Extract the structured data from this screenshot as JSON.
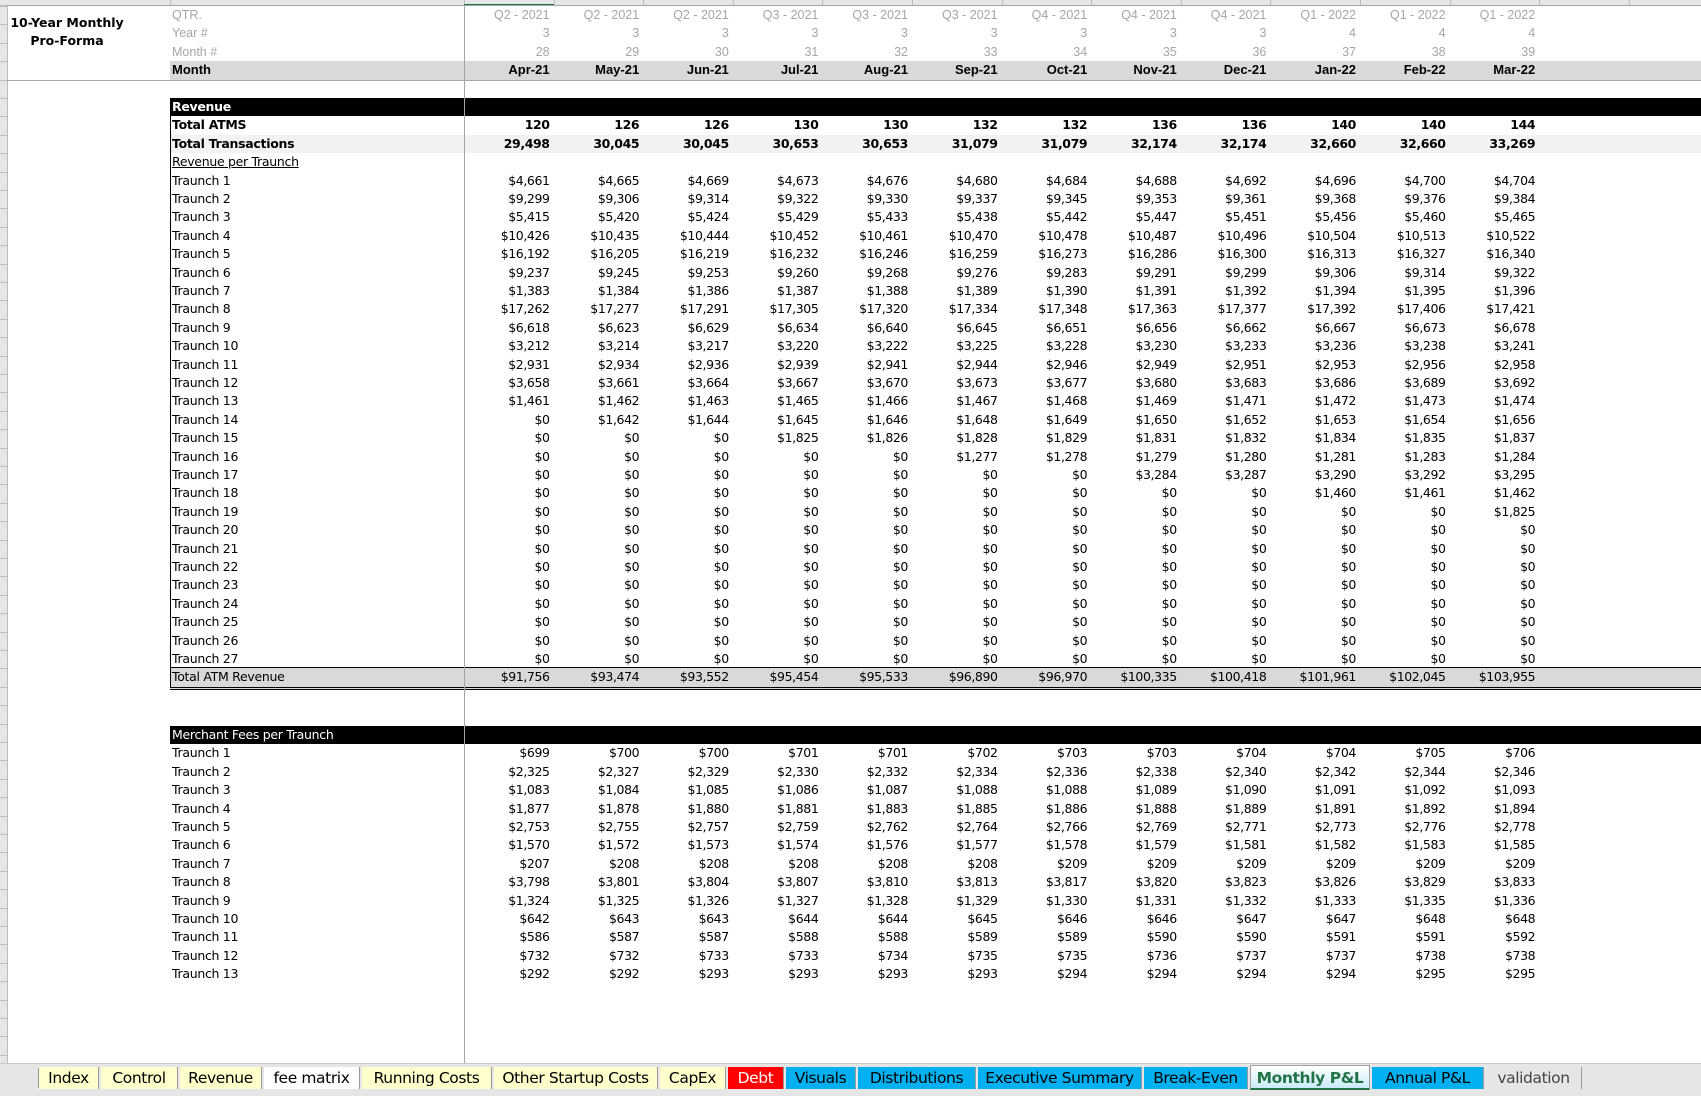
{
  "title": "10-Year Monthly Pro-Forma",
  "title_lines": [
    "10-Year Monthly",
    "Pro-Forma"
  ],
  "header": {
    "labels": {
      "qtr": "QTR.",
      "year": "Year #",
      "month_num": "Month #",
      "month": "Month"
    },
    "qtr": [
      "Q2 - 2021",
      "Q2 - 2021",
      "Q2 - 2021",
      "Q3 - 2021",
      "Q3 - 2021",
      "Q3 - 2021",
      "Q4 - 2021",
      "Q4 - 2021",
      "Q4 - 2021",
      "Q1 - 2022",
      "Q1 - 2022",
      "Q1 - 2022"
    ],
    "year": [
      "3",
      "3",
      "3",
      "3",
      "3",
      "3",
      "3",
      "3",
      "3",
      "4",
      "4",
      "4"
    ],
    "month_num": [
      "28",
      "29",
      "30",
      "31",
      "32",
      "33",
      "34",
      "35",
      "36",
      "37",
      "38",
      "39"
    ],
    "month": [
      "Apr-21",
      "May-21",
      "Jun-21",
      "Jul-21",
      "Aug-21",
      "Sep-21",
      "Oct-21",
      "Nov-21",
      "Dec-21",
      "Jan-22",
      "Feb-22",
      "Mar-22"
    ]
  },
  "revenue": {
    "section_label": "Revenue",
    "total_atms": {
      "label": "Total ATMS",
      "values": [
        "120",
        "126",
        "126",
        "130",
        "130",
        "132",
        "132",
        "136",
        "136",
        "140",
        "140",
        "144"
      ]
    },
    "total_transactions": {
      "label": "Total Transactions",
      "values": [
        "29,498",
        "30,045",
        "30,045",
        "30,653",
        "30,653",
        "31,079",
        "31,079",
        "32,174",
        "32,174",
        "32,660",
        "32,660",
        "33,269"
      ]
    },
    "subheader": "Revenue per Traunch",
    "traunches": [
      {
        "label": "Traunch 1",
        "values": [
          "$4,661",
          "$4,665",
          "$4,669",
          "$4,673",
          "$4,676",
          "$4,680",
          "$4,684",
          "$4,688",
          "$4,692",
          "$4,696",
          "$4,700",
          "$4,704"
        ]
      },
      {
        "label": "Traunch 2",
        "values": [
          "$9,299",
          "$9,306",
          "$9,314",
          "$9,322",
          "$9,330",
          "$9,337",
          "$9,345",
          "$9,353",
          "$9,361",
          "$9,368",
          "$9,376",
          "$9,384"
        ]
      },
      {
        "label": "Traunch 3",
        "values": [
          "$5,415",
          "$5,420",
          "$5,424",
          "$5,429",
          "$5,433",
          "$5,438",
          "$5,442",
          "$5,447",
          "$5,451",
          "$5,456",
          "$5,460",
          "$5,465"
        ]
      },
      {
        "label": "Traunch 4",
        "values": [
          "$10,426",
          "$10,435",
          "$10,444",
          "$10,452",
          "$10,461",
          "$10,470",
          "$10,478",
          "$10,487",
          "$10,496",
          "$10,504",
          "$10,513",
          "$10,522"
        ]
      },
      {
        "label": "Traunch 5",
        "values": [
          "$16,192",
          "$16,205",
          "$16,219",
          "$16,232",
          "$16,246",
          "$16,259",
          "$16,273",
          "$16,286",
          "$16,300",
          "$16,313",
          "$16,327",
          "$16,340"
        ]
      },
      {
        "label": "Traunch 6",
        "values": [
          "$9,237",
          "$9,245",
          "$9,253",
          "$9,260",
          "$9,268",
          "$9,276",
          "$9,283",
          "$9,291",
          "$9,299",
          "$9,306",
          "$9,314",
          "$9,322"
        ]
      },
      {
        "label": "Traunch 7",
        "values": [
          "$1,383",
          "$1,384",
          "$1,386",
          "$1,387",
          "$1,388",
          "$1,389",
          "$1,390",
          "$1,391",
          "$1,392",
          "$1,394",
          "$1,395",
          "$1,396"
        ]
      },
      {
        "label": "Traunch 8",
        "values": [
          "$17,262",
          "$17,277",
          "$17,291",
          "$17,305",
          "$17,320",
          "$17,334",
          "$17,348",
          "$17,363",
          "$17,377",
          "$17,392",
          "$17,406",
          "$17,421"
        ]
      },
      {
        "label": "Traunch 9",
        "values": [
          "$6,618",
          "$6,623",
          "$6,629",
          "$6,634",
          "$6,640",
          "$6,645",
          "$6,651",
          "$6,656",
          "$6,662",
          "$6,667",
          "$6,673",
          "$6,678"
        ]
      },
      {
        "label": "Traunch 10",
        "values": [
          "$3,212",
          "$3,214",
          "$3,217",
          "$3,220",
          "$3,222",
          "$3,225",
          "$3,228",
          "$3,230",
          "$3,233",
          "$3,236",
          "$3,238",
          "$3,241"
        ]
      },
      {
        "label": "Traunch 11",
        "values": [
          "$2,931",
          "$2,934",
          "$2,936",
          "$2,939",
          "$2,941",
          "$2,944",
          "$2,946",
          "$2,949",
          "$2,951",
          "$2,953",
          "$2,956",
          "$2,958"
        ]
      },
      {
        "label": "Traunch 12",
        "values": [
          "$3,658",
          "$3,661",
          "$3,664",
          "$3,667",
          "$3,670",
          "$3,673",
          "$3,677",
          "$3,680",
          "$3,683",
          "$3,686",
          "$3,689",
          "$3,692"
        ]
      },
      {
        "label": "Traunch 13",
        "values": [
          "$1,461",
          "$1,462",
          "$1,463",
          "$1,465",
          "$1,466",
          "$1,467",
          "$1,468",
          "$1,469",
          "$1,471",
          "$1,472",
          "$1,473",
          "$1,474"
        ]
      },
      {
        "label": "Traunch 14",
        "values": [
          "$0",
          "$1,642",
          "$1,644",
          "$1,645",
          "$1,646",
          "$1,648",
          "$1,649",
          "$1,650",
          "$1,652",
          "$1,653",
          "$1,654",
          "$1,656"
        ]
      },
      {
        "label": "Traunch 15",
        "values": [
          "$0",
          "$0",
          "$0",
          "$1,825",
          "$1,826",
          "$1,828",
          "$1,829",
          "$1,831",
          "$1,832",
          "$1,834",
          "$1,835",
          "$1,837"
        ]
      },
      {
        "label": "Traunch 16",
        "values": [
          "$0",
          "$0",
          "$0",
          "$0",
          "$0",
          "$1,277",
          "$1,278",
          "$1,279",
          "$1,280",
          "$1,281",
          "$1,283",
          "$1,284"
        ]
      },
      {
        "label": "Traunch 17",
        "values": [
          "$0",
          "$0",
          "$0",
          "$0",
          "$0",
          "$0",
          "$0",
          "$3,284",
          "$3,287",
          "$3,290",
          "$3,292",
          "$3,295"
        ]
      },
      {
        "label": "Traunch 18",
        "values": [
          "$0",
          "$0",
          "$0",
          "$0",
          "$0",
          "$0",
          "$0",
          "$0",
          "$0",
          "$1,460",
          "$1,461",
          "$1,462"
        ]
      },
      {
        "label": "Traunch 19",
        "values": [
          "$0",
          "$0",
          "$0",
          "$0",
          "$0",
          "$0",
          "$0",
          "$0",
          "$0",
          "$0",
          "$0",
          "$1,825"
        ]
      },
      {
        "label": "Traunch 20",
        "values": [
          "$0",
          "$0",
          "$0",
          "$0",
          "$0",
          "$0",
          "$0",
          "$0",
          "$0",
          "$0",
          "$0",
          "$0"
        ]
      },
      {
        "label": "Traunch 21",
        "values": [
          "$0",
          "$0",
          "$0",
          "$0",
          "$0",
          "$0",
          "$0",
          "$0",
          "$0",
          "$0",
          "$0",
          "$0"
        ]
      },
      {
        "label": "Traunch 22",
        "values": [
          "$0",
          "$0",
          "$0",
          "$0",
          "$0",
          "$0",
          "$0",
          "$0",
          "$0",
          "$0",
          "$0",
          "$0"
        ]
      },
      {
        "label": "Traunch 23",
        "values": [
          "$0",
          "$0",
          "$0",
          "$0",
          "$0",
          "$0",
          "$0",
          "$0",
          "$0",
          "$0",
          "$0",
          "$0"
        ]
      },
      {
        "label": "Traunch 24",
        "values": [
          "$0",
          "$0",
          "$0",
          "$0",
          "$0",
          "$0",
          "$0",
          "$0",
          "$0",
          "$0",
          "$0",
          "$0"
        ]
      },
      {
        "label": "Traunch 25",
        "values": [
          "$0",
          "$0",
          "$0",
          "$0",
          "$0",
          "$0",
          "$0",
          "$0",
          "$0",
          "$0",
          "$0",
          "$0"
        ]
      },
      {
        "label": "Traunch 26",
        "values": [
          "$0",
          "$0",
          "$0",
          "$0",
          "$0",
          "$0",
          "$0",
          "$0",
          "$0",
          "$0",
          "$0",
          "$0"
        ]
      },
      {
        "label": "Traunch 27",
        "values": [
          "$0",
          "$0",
          "$0",
          "$0",
          "$0",
          "$0",
          "$0",
          "$0",
          "$0",
          "$0",
          "$0",
          "$0"
        ]
      }
    ],
    "total": {
      "label": "Total ATM Revenue",
      "values": [
        "$91,756",
        "$93,474",
        "$93,552",
        "$95,454",
        "$95,533",
        "$96,890",
        "$96,970",
        "$100,335",
        "$100,418",
        "$101,961",
        "$102,045",
        "$103,955"
      ]
    }
  },
  "merchant_fees": {
    "section_label": "Merchant Fees per Traunch",
    "traunches": [
      {
        "label": "Traunch 1",
        "values": [
          "$699",
          "$700",
          "$700",
          "$701",
          "$701",
          "$702",
          "$703",
          "$703",
          "$704",
          "$704",
          "$705",
          "$706"
        ]
      },
      {
        "label": "Traunch 2",
        "values": [
          "$2,325",
          "$2,327",
          "$2,329",
          "$2,330",
          "$2,332",
          "$2,334",
          "$2,336",
          "$2,338",
          "$2,340",
          "$2,342",
          "$2,344",
          "$2,346"
        ]
      },
      {
        "label": "Traunch 3",
        "values": [
          "$1,083",
          "$1,084",
          "$1,085",
          "$1,086",
          "$1,087",
          "$1,088",
          "$1,088",
          "$1,089",
          "$1,090",
          "$1,091",
          "$1,092",
          "$1,093"
        ]
      },
      {
        "label": "Traunch 4",
        "values": [
          "$1,877",
          "$1,878",
          "$1,880",
          "$1,881",
          "$1,883",
          "$1,885",
          "$1,886",
          "$1,888",
          "$1,889",
          "$1,891",
          "$1,892",
          "$1,894"
        ]
      },
      {
        "label": "Traunch 5",
        "values": [
          "$2,753",
          "$2,755",
          "$2,757",
          "$2,759",
          "$2,762",
          "$2,764",
          "$2,766",
          "$2,769",
          "$2,771",
          "$2,773",
          "$2,776",
          "$2,778"
        ]
      },
      {
        "label": "Traunch 6",
        "values": [
          "$1,570",
          "$1,572",
          "$1,573",
          "$1,574",
          "$1,576",
          "$1,577",
          "$1,578",
          "$1,579",
          "$1,581",
          "$1,582",
          "$1,583",
          "$1,585"
        ]
      },
      {
        "label": "Traunch 7",
        "values": [
          "$207",
          "$208",
          "$208",
          "$208",
          "$208",
          "$208",
          "$209",
          "$209",
          "$209",
          "$209",
          "$209",
          "$209"
        ]
      },
      {
        "label": "Traunch 8",
        "values": [
          "$3,798",
          "$3,801",
          "$3,804",
          "$3,807",
          "$3,810",
          "$3,813",
          "$3,817",
          "$3,820",
          "$3,823",
          "$3,826",
          "$3,829",
          "$3,833"
        ]
      },
      {
        "label": "Traunch 9",
        "values": [
          "$1,324",
          "$1,325",
          "$1,326",
          "$1,327",
          "$1,328",
          "$1,329",
          "$1,330",
          "$1,331",
          "$1,332",
          "$1,333",
          "$1,335",
          "$1,336"
        ]
      },
      {
        "label": "Traunch 10",
        "values": [
          "$642",
          "$643",
          "$643",
          "$644",
          "$644",
          "$645",
          "$646",
          "$646",
          "$647",
          "$647",
          "$648",
          "$648"
        ]
      },
      {
        "label": "Traunch 11",
        "values": [
          "$586",
          "$587",
          "$587",
          "$588",
          "$588",
          "$589",
          "$589",
          "$590",
          "$590",
          "$591",
          "$591",
          "$592"
        ]
      },
      {
        "label": "Traunch 12",
        "values": [
          "$732",
          "$732",
          "$733",
          "$733",
          "$734",
          "$735",
          "$735",
          "$736",
          "$737",
          "$737",
          "$738",
          "$738"
        ]
      },
      {
        "label": "Traunch 13",
        "values": [
          "$292",
          "$292",
          "$293",
          "$293",
          "$293",
          "$293",
          "$294",
          "$294",
          "$294",
          "$294",
          "$295",
          "$295"
        ]
      }
    ]
  },
  "tabs": [
    {
      "label": "Index",
      "style": "yellow"
    },
    {
      "label": "Control",
      "style": "yellow"
    },
    {
      "label": "Revenue",
      "style": "yellow"
    },
    {
      "label": "fee matrix",
      "style": "white"
    },
    {
      "label": "Running Costs",
      "style": "yellow"
    },
    {
      "label": "Other Startup Costs",
      "style": "yellow"
    },
    {
      "label": "CapEx",
      "style": "yellow"
    },
    {
      "label": "Debt",
      "style": "red"
    },
    {
      "label": "Visuals",
      "style": "blue"
    },
    {
      "label": "Distributions",
      "style": "blue"
    },
    {
      "label": "Executive Summary",
      "style": "blue"
    },
    {
      "label": "Break-Even",
      "style": "blue"
    },
    {
      "label": "Monthly P&L",
      "style": "active"
    },
    {
      "label": "Annual P&L",
      "style": "blue"
    },
    {
      "label": "validation",
      "style": "plain"
    }
  ],
  "active_tab": "Monthly P&L",
  "colors": {
    "tab_yellow": "#ffffcc",
    "tab_blue": "#00b0f0",
    "tab_red": "#ff0000",
    "excel_green": "#217346",
    "section_black": "#000000"
  }
}
